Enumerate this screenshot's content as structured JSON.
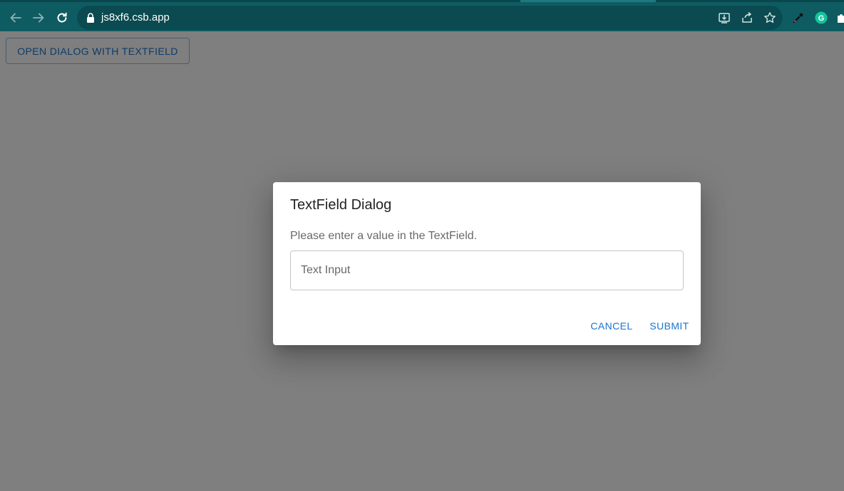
{
  "browser": {
    "url": "js8xf6.csb.app",
    "icons": [
      "back-arrow-icon",
      "forward-arrow-icon",
      "reload-icon",
      "lock-icon",
      "install-icon",
      "share-icon",
      "star-icon",
      "eyedropper-icon",
      "grammarly-icon",
      "puzzle-icon"
    ],
    "colors": {
      "chrome": "#0e5c62",
      "omnibox": "#0a4a50"
    }
  },
  "page": {
    "open_button_label": "OPEN DIALOG WITH TEXTFIELD"
  },
  "dialog": {
    "title": "TextField Dialog",
    "description": "Please enter a value in the TextField.",
    "input_placeholder": "Text Input",
    "input_value": "",
    "cancel_label": "CANCEL",
    "submit_label": "SUBMIT"
  },
  "theme": {
    "primary": "#1976d2"
  }
}
